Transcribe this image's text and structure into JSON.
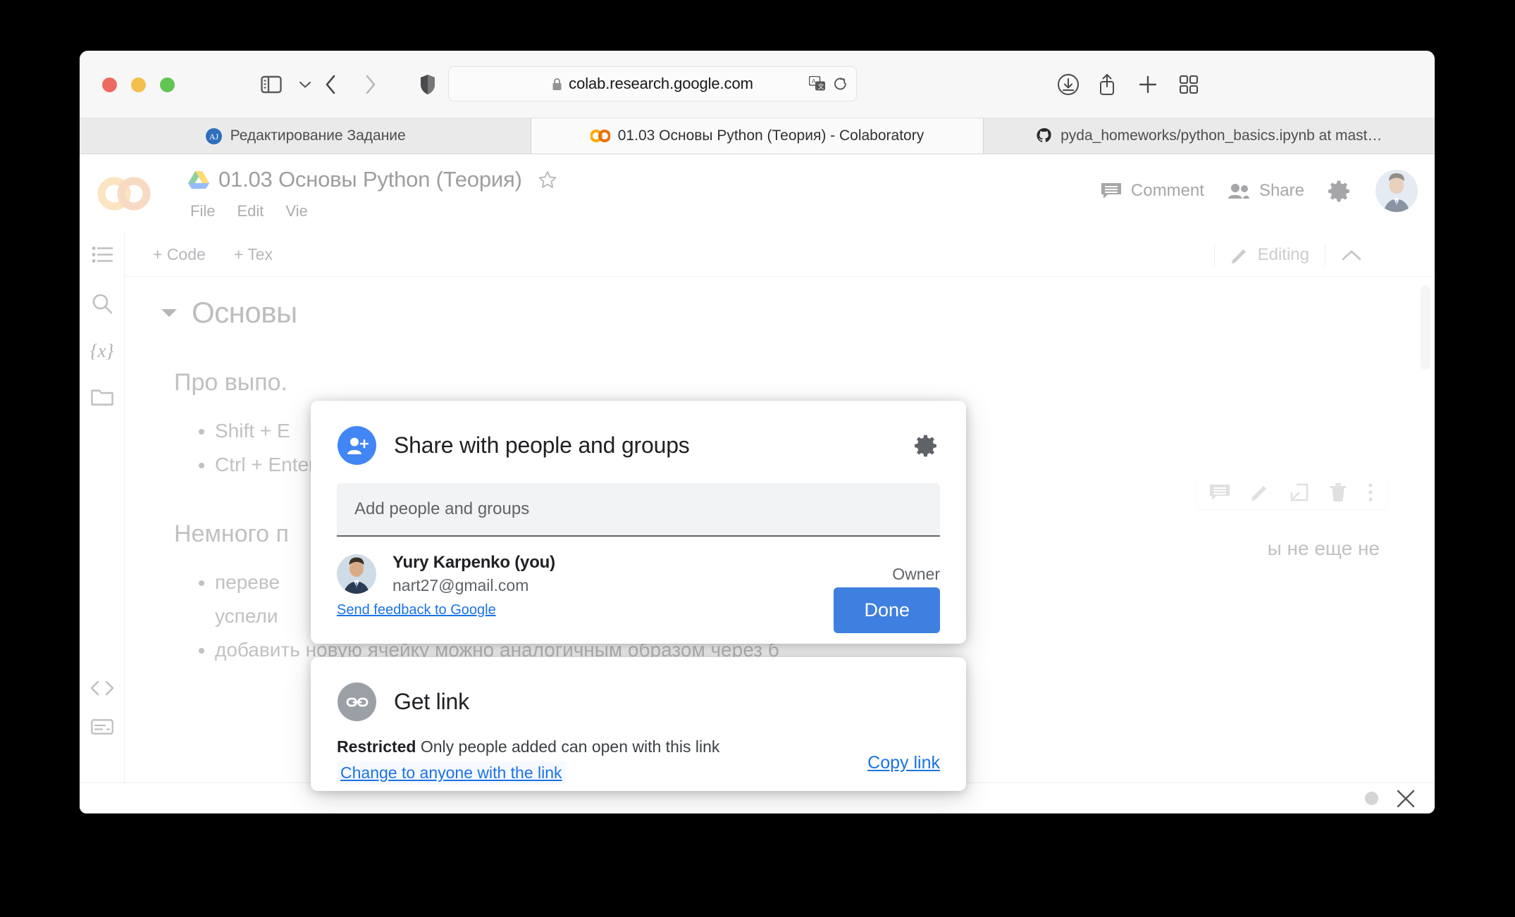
{
  "browser": {
    "url": "colab.research.google.com",
    "lock_icon": "lock-icon",
    "translate_icon": "translate-icon",
    "reload_icon": "reload-icon",
    "sidebar_icon": "sidebar-toggle-icon",
    "chevron_icon": "chevron-down-icon",
    "back_icon": "back-arrow-icon",
    "forward_icon": "forward-arrow-icon",
    "shield_icon": "shield-icon",
    "download_icon": "download-icon",
    "share_icon": "share-icon",
    "new_tab_icon": "plus-icon",
    "tab_overview_icon": "tab-overview-icon",
    "tabs": [
      {
        "label": "Редактирование Задание",
        "favicon": "blue-circle-icon",
        "active": false
      },
      {
        "label": "01.03 Основы Python (Теория) - Colaboratory",
        "favicon": "colab-icon",
        "active": true
      },
      {
        "label": "pyda_homeworks/python_basics.ipynb at mast…",
        "favicon": "github-icon",
        "active": false
      }
    ]
  },
  "colab": {
    "logo": "colab-logo",
    "drive_icon": "drive-icon",
    "doc_title": "01.03 Основы Python (Теория)",
    "star_icon": "star-icon",
    "menu": [
      "File",
      "Edit",
      "Vie"
    ],
    "comment_label": "Comment",
    "comment_icon": "comment-icon",
    "share_label": "Share",
    "share_icon": "people-icon",
    "settings_icon": "gear-icon",
    "avatar": "user-avatar",
    "toolbar": {
      "add_code": "+ Code",
      "add_text": "+ Tex",
      "editing_label": "Editing",
      "editing_icon": "pencil-icon",
      "collapse_icon": "chevron-up-icon"
    },
    "rail": [
      "table-of-contents-icon",
      "search-icon",
      "variables-icon",
      "files-folder-icon",
      "code-snippets-icon",
      "terminal-icon"
    ],
    "rail_vars_label": "{x}",
    "notebook": {
      "heading": "Основы",
      "section_1": "Про выпо.",
      "bullets_1": [
        "Shift + E",
        "Ctrl + Enter"
      ],
      "section_2": "Немного п",
      "bullets_2": [
        "переве",
        "успели",
        "добавить новую ячейку можно аналогичным образом через б"
      ],
      "side_fragment": "ы не еще не"
    },
    "cell_actions": [
      "comment-icon",
      "edit-pencil-icon",
      "open-in-new-icon",
      "delete-trash-icon",
      "more-vertical-icon"
    ],
    "footer": {
      "status_dot": "status-dot",
      "close_icon": "close-icon"
    }
  },
  "share_dialog": {
    "people": {
      "icon": "person-add-icon",
      "title": "Share with people and groups",
      "settings_icon": "gear-icon",
      "input_placeholder": "Add people and groups",
      "input_value": "",
      "person": {
        "avatar": "user-avatar",
        "name": "Yury Karpenko (you)",
        "email": "nart27@gmail.com",
        "role": "Owner"
      },
      "feedback_link": "Send feedback to Google",
      "done_label": "Done"
    },
    "link": {
      "icon": "link-icon",
      "title": "Get link",
      "status_label": "Restricted",
      "status_text": "Only people added can open with this link",
      "change_label": "Change to anyone with the link",
      "copy_label": "Copy link"
    }
  },
  "colors": {
    "accent_blue": "#1a73e8",
    "done_button": "#3f7fe0",
    "person_add_circle": "#4285f4",
    "link_circle": "#9aa0a6"
  }
}
